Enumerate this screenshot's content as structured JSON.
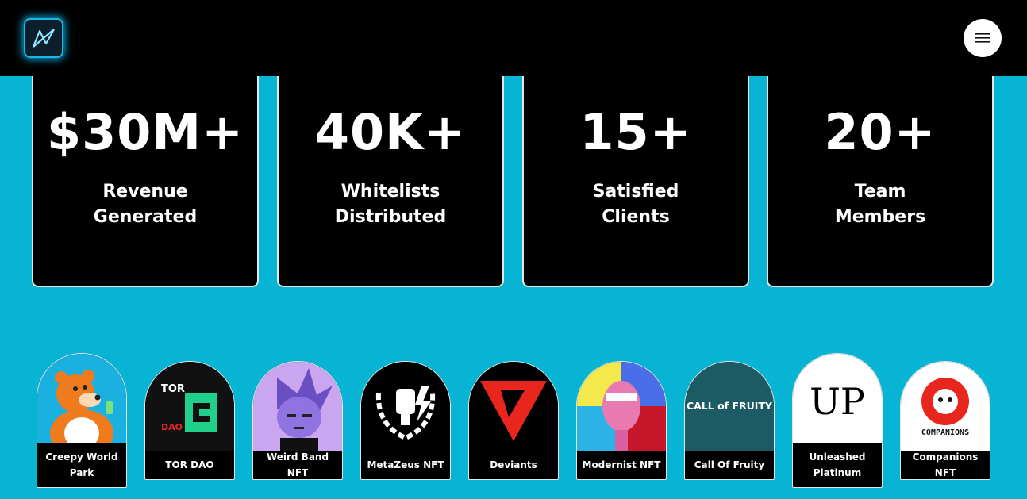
{
  "header": {
    "logo_icon": "triangle-logo-icon",
    "menu_icon": "hamburger-menu-icon"
  },
  "stats": [
    {
      "value": "$30M+",
      "label_line1": "Revenue",
      "label_line2": "Generated"
    },
    {
      "value": "40K+",
      "label_line1": "Whitelists",
      "label_line2": "Distributed"
    },
    {
      "value": "15+",
      "label_line1": "Satisfied",
      "label_line2": "Clients"
    },
    {
      "value": "20+",
      "label_line1": "Team",
      "label_line2": "Members"
    }
  ],
  "projects": [
    {
      "name": "Creepy World Park"
    },
    {
      "name": "TOR DAO",
      "art_text_top": "TOR",
      "art_text_bottom": "DAO"
    },
    {
      "name": "Weird Band NFT"
    },
    {
      "name": "MetaZeus NFT"
    },
    {
      "name": "Deviants"
    },
    {
      "name": "Modernist NFT"
    },
    {
      "name": "Call Of Fruity",
      "art_text": "CALL of FRUITY"
    },
    {
      "name": "Unleashed Platinum",
      "art_text": "UP"
    },
    {
      "name": "Companions NFT",
      "art_text": "COMPANIONS"
    }
  ],
  "colors": {
    "background": "#08b4d4",
    "card": "#000000",
    "accent_red": "#e8261e",
    "accent_green": "#1fd08a"
  }
}
